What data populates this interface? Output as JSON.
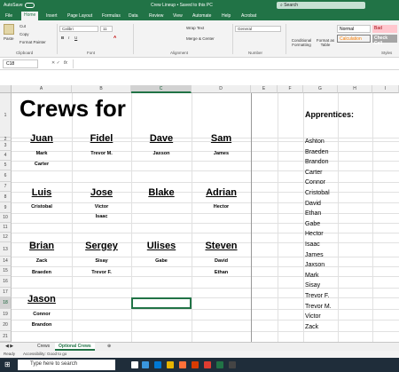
{
  "titlebar": {
    "autosave": "AutoSave",
    "title": "Crew Lineup • Saved to this PC",
    "search": "Search"
  },
  "menu": [
    "File",
    "Home",
    "Insert",
    "Page Layout",
    "Formulas",
    "Data",
    "Review",
    "View",
    "Automate",
    "Help",
    "Acrobat"
  ],
  "ribbon": {
    "paste": "Paste",
    "cut": "Cut",
    "copy": "Copy",
    "format_painter": "Format Painter",
    "clipboard": "Clipboard",
    "font_name": "Calibri",
    "font_size": "11",
    "font": "Font",
    "wrap_text": "Wrap Text",
    "merge_center": "Merge & Center",
    "alignment": "Alignment",
    "number_format": "General",
    "number": "Number",
    "conditional": "Conditional Formatting",
    "format_table": "Format as Table",
    "styles": "Styles",
    "style_normal": "Normal",
    "style_bad": "Bad",
    "style_calc": "Calculation",
    "style_check": "Check Cell"
  },
  "formula": {
    "namebox": "C18",
    "fx": "fx",
    "content": ""
  },
  "columns": [
    "A",
    "B",
    "C",
    "D",
    "E",
    "F",
    "G",
    "H",
    "I"
  ],
  "rows": [
    "1",
    "2",
    "3",
    "4",
    "5",
    "6",
    "7",
    "8",
    "9",
    "10",
    "11",
    "12",
    "13",
    "14",
    "15",
    "16",
    "17",
    "18",
    "19",
    "20",
    "21"
  ],
  "sheet": {
    "title": "Crews for",
    "crews": [
      {
        "leader": "Juan",
        "members": [
          "Mark",
          "Carter"
        ]
      },
      {
        "leader": "Fidel",
        "members": [
          "Trevor M."
        ]
      },
      {
        "leader": "Dave",
        "members": [
          "Jaxson"
        ]
      },
      {
        "leader": "Sam",
        "members": [
          "James"
        ]
      },
      {
        "leader": "Luis",
        "members": [
          "Cristobal"
        ]
      },
      {
        "leader": "Jose",
        "members": [
          "Victor",
          "Isaac"
        ]
      },
      {
        "leader": "Blake",
        "members": []
      },
      {
        "leader": "Adrian",
        "members": [
          "Hector"
        ]
      },
      {
        "leader": "Brian",
        "members": [
          "Zack",
          "Braeden"
        ]
      },
      {
        "leader": "Sergey",
        "members": [
          "Sisay",
          "Trevor F."
        ]
      },
      {
        "leader": "Ulises",
        "members": [
          "Gabe"
        ]
      },
      {
        "leader": "Steven",
        "members": [
          "David",
          "Ethan"
        ]
      },
      {
        "leader": "Jason",
        "members": [
          "Connor",
          "Brandon"
        ]
      }
    ],
    "apprentices_title": "Apprentices:",
    "apprentices": [
      "Ashton",
      "Braeden",
      "Brandon",
      "Carter",
      "Connor",
      "Cristobal",
      "David",
      "Ethan",
      "Gabe",
      "Hector",
      "Isaac",
      "James",
      "Jaxson",
      "Mark",
      "Sisay",
      "Trevor F.",
      "Trevor M.",
      "Victor",
      "Zack"
    ]
  },
  "tabs": [
    "Crews",
    "Optional Crews"
  ],
  "status": {
    "ready": "Ready",
    "accessibility": "Accessibility: Good to go"
  },
  "taskbar": {
    "search": "Type here to search"
  }
}
